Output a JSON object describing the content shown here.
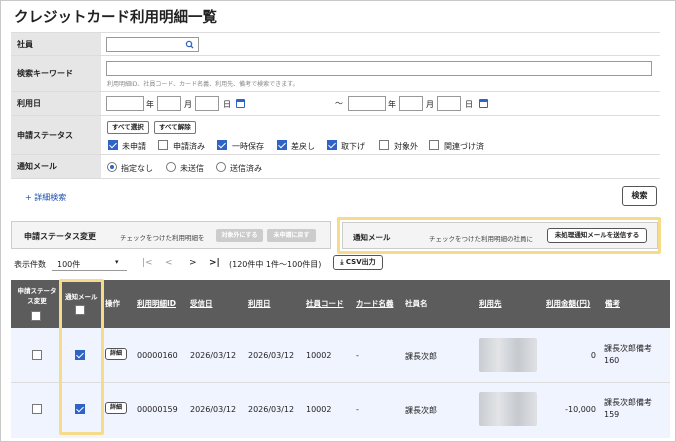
{
  "page": {
    "title": "クレジットカード利用明細一覧"
  },
  "filters": {
    "employee": {
      "label": "社員"
    },
    "keyword": {
      "label": "検索キーワード",
      "hint": "利用明細ID、社員コード、カード名義、利用先、備考で検索できます。"
    },
    "usage_date": {
      "label": "利用日",
      "year": "年",
      "month": "月",
      "day": "日",
      "tilde": "〜"
    },
    "status": {
      "label": "申請ステータス",
      "select_all": "すべて選択",
      "deselect_all": "すべて解除",
      "options": [
        {
          "label": "未申請",
          "checked": true
        },
        {
          "label": "申請済み",
          "checked": false
        },
        {
          "label": "一時保存",
          "checked": true
        },
        {
          "label": "差戻し",
          "checked": true
        },
        {
          "label": "取下げ",
          "checked": true
        },
        {
          "label": "対象外",
          "checked": false
        },
        {
          "label": "関連づけ済",
          "checked": false
        }
      ]
    },
    "notify": {
      "label": "通知メール",
      "options": [
        {
          "label": "指定なし",
          "selected": true
        },
        {
          "label": "未送信",
          "selected": false
        },
        {
          "label": "送信済み",
          "selected": false
        }
      ]
    },
    "advanced_link": "+ 詳細検索",
    "search_button": "検索"
  },
  "status_change": {
    "title": "申請ステータス変更",
    "desc": "チェックをつけた利用明細を",
    "btn1": "対象外にする",
    "btn2": "未申請に戻す"
  },
  "notify_panel": {
    "title": "通知メール",
    "desc": "チェックをつけた利用明細の社員に",
    "button": "未処理通知メールを送信する"
  },
  "pagination": {
    "label": "表示件数",
    "per_page": "100件",
    "first": "|<",
    "prev": "<",
    "next": ">",
    "last": ">|",
    "summary": "(120件中 1件〜100件目)",
    "csv": "CSV出力"
  },
  "table": {
    "headers": {
      "status_change": "申請ステータス変更",
      "notify": "通知メール",
      "action": "操作",
      "id": "利用明細ID",
      "received": "受信日",
      "used": "利用日",
      "emp_code": "社員コード",
      "card_name": "カード名義",
      "emp_name": "社員名",
      "payee": "利用先",
      "amount": "利用金額(円)",
      "note": "備考"
    },
    "rows": [
      {
        "detail": "詳細",
        "id": "00000160",
        "received": "2026/03/12",
        "used": "2026/03/12",
        "emp_code": "10002",
        "card_name": "-",
        "emp_name": "課長次郎",
        "amount": "0",
        "note1": "課長次郎備考",
        "note2": "160",
        "notify_checked": true
      },
      {
        "detail": "詳細",
        "id": "00000159",
        "received": "2026/03/12",
        "used": "2026/03/12",
        "emp_code": "10002",
        "card_name": "-",
        "emp_name": "課長次郎",
        "amount": "-10,000",
        "note1": "課長次郎備考",
        "note2": "159",
        "notify_checked": true
      }
    ]
  }
}
